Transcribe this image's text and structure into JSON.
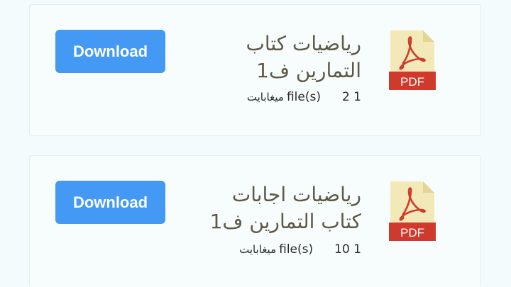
{
  "files": [
    {
      "title": "رياضيات كتاب التمارين ف1",
      "size": "2 1",
      "size_unit": "ميغابايت",
      "count_label": "file(s)",
      "download_label": "Download",
      "icon": "pdf-file-icon",
      "icon_text": "PDF"
    },
    {
      "title": "رياضيات اجابات كتاب التمارين ف1",
      "size": "10 1",
      "size_unit": "ميغابايت",
      "count_label": "file(s)",
      "download_label": "Download",
      "icon": "pdf-file-icon",
      "icon_text": "PDF"
    }
  ],
  "colors": {
    "background": "#f4fbfc",
    "button": "#4399f3",
    "title": "#5d5944",
    "pdf_red": "#d03a2c",
    "pdf_page": "#f3e8b8"
  }
}
